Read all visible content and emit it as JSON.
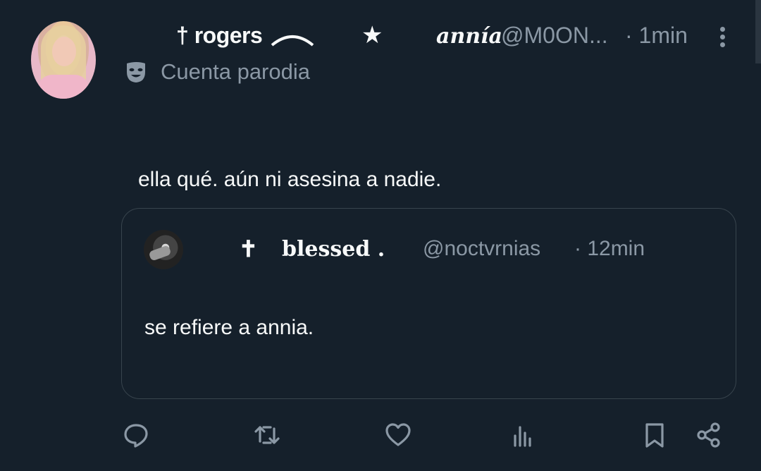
{
  "author": {
    "display_name_part1": "† rogers",
    "star": "★",
    "display_name_part2": "annía",
    "handle": "@M0ON...",
    "time": "· 1min",
    "label": "Cuenta parodia"
  },
  "tweet": {
    "text": "ella qué. aún ni asesina a nadie."
  },
  "quoted": {
    "dagger": "✝",
    "display_name": "blessed .",
    "handle": "@noctvrnias",
    "time": "· 12min",
    "text": "se refiere a annia."
  },
  "icons": {
    "parody": "theater-mask-icon",
    "more": "more-vertical-icon",
    "reply": "reply-icon",
    "retweet": "retweet-icon",
    "like": "heart-icon",
    "views": "views-icon",
    "bookmark": "bookmark-icon",
    "share": "share-icon"
  },
  "colors": {
    "background": "#15202b",
    "text_primary": "#f7f9f9",
    "text_secondary": "#8b98a5",
    "border": "#38444d"
  }
}
